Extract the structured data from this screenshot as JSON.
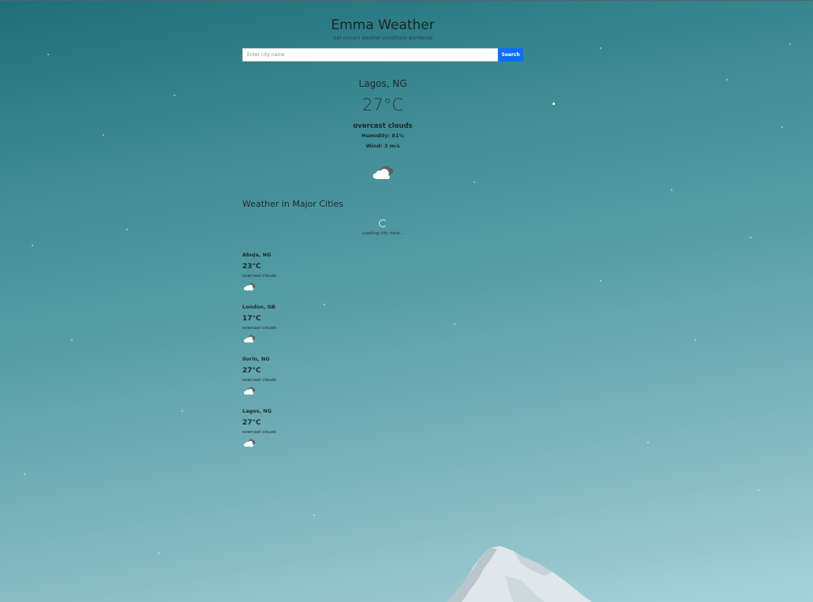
{
  "header": {
    "title": "Emma Weather",
    "subtitle": "Get current weather conditions worldwide"
  },
  "search": {
    "placeholder": "Enter city name",
    "value": "",
    "button_label": "Search"
  },
  "current": {
    "city": "Lagos, NG",
    "temperature": "27°C",
    "description": "overcast clouds",
    "humidity": "Humidity: 81%",
    "wind": "Wind: 3 m/s",
    "icon": "overcast-clouds-icon"
  },
  "major_cities": {
    "title": "Weather in Major Cities",
    "loading_text": "Loading city data...",
    "items": [
      {
        "name": "Abuja, NG",
        "temp": "23°C",
        "description": "overcast clouds",
        "icon": "overcast-clouds-icon"
      },
      {
        "name": "London, GB",
        "temp": "17°C",
        "description": "overcast clouds",
        "icon": "overcast-clouds-icon"
      },
      {
        "name": "Ilorin, NG",
        "temp": "27°C",
        "description": "overcast clouds",
        "icon": "overcast-clouds-icon"
      },
      {
        "name": "Lagos, NG",
        "temp": "27°C",
        "description": "overcast clouds",
        "icon": "overcast-clouds-icon"
      }
    ]
  },
  "colors": {
    "accent": "#0d6efd",
    "background_top": "#1f6f78",
    "background_bottom": "#a7d3d8"
  }
}
